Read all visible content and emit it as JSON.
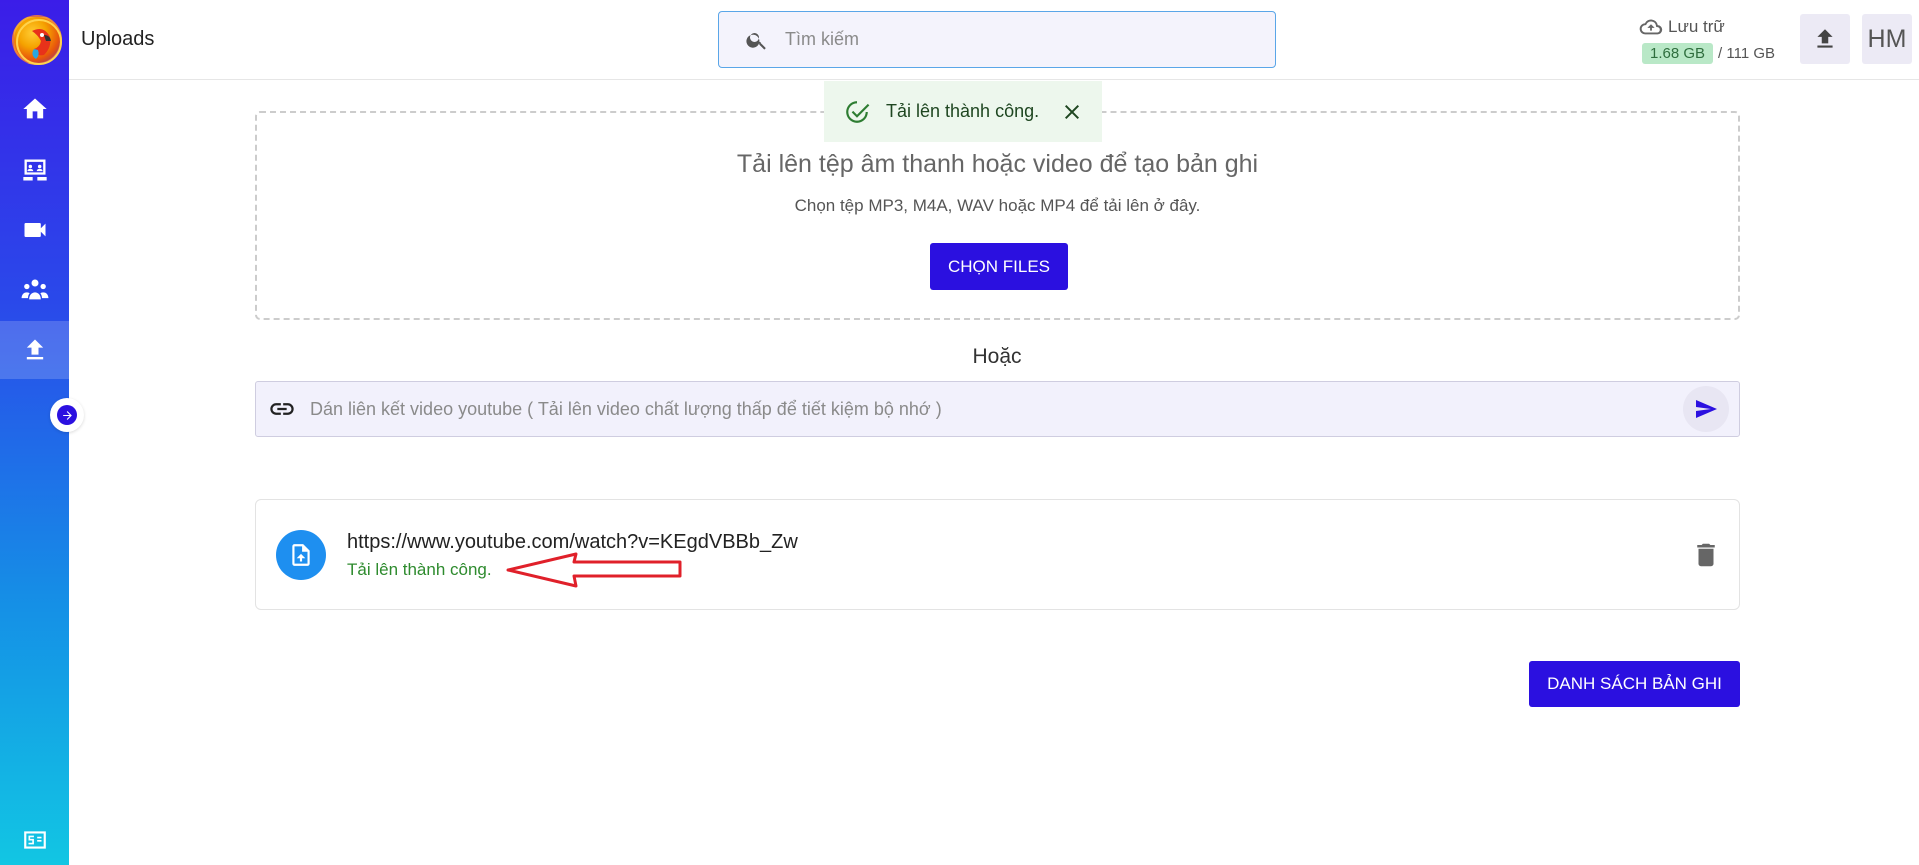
{
  "header": {
    "title": "Uploads",
    "search_placeholder": "Tìm kiếm",
    "storage_label": "Lưu trữ",
    "storage_used": "1.68 GB",
    "storage_total": "/ 111 GB",
    "avatar_initials": "HM"
  },
  "toast": {
    "message": "Tải lên thành công."
  },
  "dropzone": {
    "title": "Tải lên tệp âm thanh hoặc video để tạo bản ghi",
    "subtitle": "Chọn tệp MP3, M4A, WAV hoặc MP4 để tải lên ở đây.",
    "button_label": "CHỌN FILES"
  },
  "or_label": "Hoặc",
  "link_input": {
    "placeholder": "Dán liên kết video youtube ( Tải lên video chất lượng thấp để tiết kiệm bộ nhớ )"
  },
  "uploads": [
    {
      "url": "https://www.youtube.com/watch?v=KEgdVBBb_Zw",
      "status": "Tải lên thành công."
    }
  ],
  "list_button_label": "DANH SÁCH BẢN GHI",
  "colors": {
    "accent": "#2b10e0",
    "success": "#2e8b2e",
    "toast_bg": "#edf7ed",
    "file_icon_bg": "#1e8ff0"
  },
  "icons": {
    "sidebar": [
      "home-icon",
      "meeting-icon",
      "video-camera-icon",
      "group-icon",
      "upload-icon"
    ],
    "bottom": "billing-icon"
  }
}
